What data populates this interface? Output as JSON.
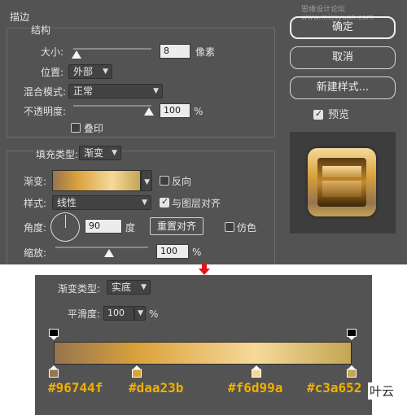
{
  "dialog": {
    "title": "描边",
    "watermark": "思缘设计论坛 www.missyuan.com"
  },
  "structure": {
    "heading": "结构",
    "size_label": "大小:",
    "size_value": "8",
    "size_unit": "像素",
    "size_slider_value": 8,
    "position_label": "位置:",
    "position_value": "外部",
    "blend_label": "混合模式:",
    "blend_value": "正常",
    "opacity_label": "不透明度:",
    "opacity_value": "100",
    "opacity_unit": "%",
    "opacity_slider_percent": 100,
    "overprint_label": "叠印",
    "overprint_checked": false
  },
  "fill": {
    "type_label": "填充类型:",
    "type_value": "渐变",
    "gradient_label": "渐变:",
    "reverse_label": "反向",
    "reverse_checked": false,
    "style_label": "样式:",
    "style_value": "线性",
    "align_label": "与图层对齐",
    "align_checked": true,
    "angle_label": "角度:",
    "angle_value": "90",
    "angle_unit": "度",
    "reset_align_label": "重置对齐",
    "dither_label": "仿色",
    "dither_checked": false,
    "scale_label": "缩放:",
    "scale_value": "100",
    "scale_unit": "%",
    "scale_slider_percent": 100
  },
  "buttons": {
    "ok": "确定",
    "cancel": "取消",
    "new_style": "新建样式...",
    "preview_label": "预览",
    "preview_checked": true
  },
  "gradient_editor": {
    "type_label": "渐变类型:",
    "type_value": "实底",
    "smooth_label": "平滑度:",
    "smooth_value": "100",
    "smooth_unit": "%",
    "stops": [
      {
        "color": "#96744f",
        "location": 0,
        "label": "#96744f"
      },
      {
        "color": "#daa23b",
        "location": 28,
        "label": "#daa23b"
      },
      {
        "color": "#f6d99a",
        "location": 68,
        "label": "#f6d99a"
      },
      {
        "color": "#c3a652",
        "location": 100,
        "label": "#c3a652"
      }
    ]
  },
  "overlay_text": "叶云",
  "colors": {
    "panel_bg": "#535353",
    "accent_text": "#f0b000",
    "arrow_red": "#e0151b"
  }
}
